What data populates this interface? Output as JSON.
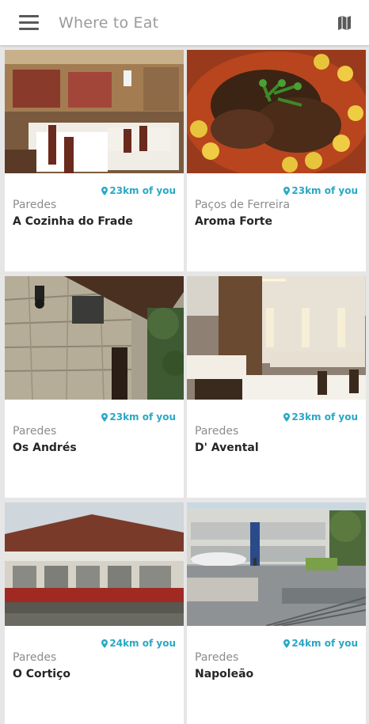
{
  "app_bar": {
    "title": "Where to Eat",
    "menu_icon": "hamburger-menu-icon",
    "map_icon": "map-icon"
  },
  "colors": {
    "accent": "#2aa8c4",
    "name_text": "#262626",
    "city_text": "#8c8c8c",
    "background": "#e6e6e6"
  },
  "restaurants": [
    {
      "city": "Paredes",
      "name": "A Cozinha do Frade",
      "distance": "23km of you"
    },
    {
      "city": "Paços de Ferreira",
      "name": "Aroma Forte",
      "distance": "23km of you"
    },
    {
      "city": "Paredes",
      "name": "Os Andrés",
      "distance": "23km of you"
    },
    {
      "city": "Paredes",
      "name": "D' Avental",
      "distance": "23km of you"
    },
    {
      "city": "Paredes",
      "name": "O Cortiço",
      "distance": "24km of you"
    },
    {
      "city": "Paredes",
      "name": "Napoleão",
      "distance": "24km of you"
    }
  ]
}
